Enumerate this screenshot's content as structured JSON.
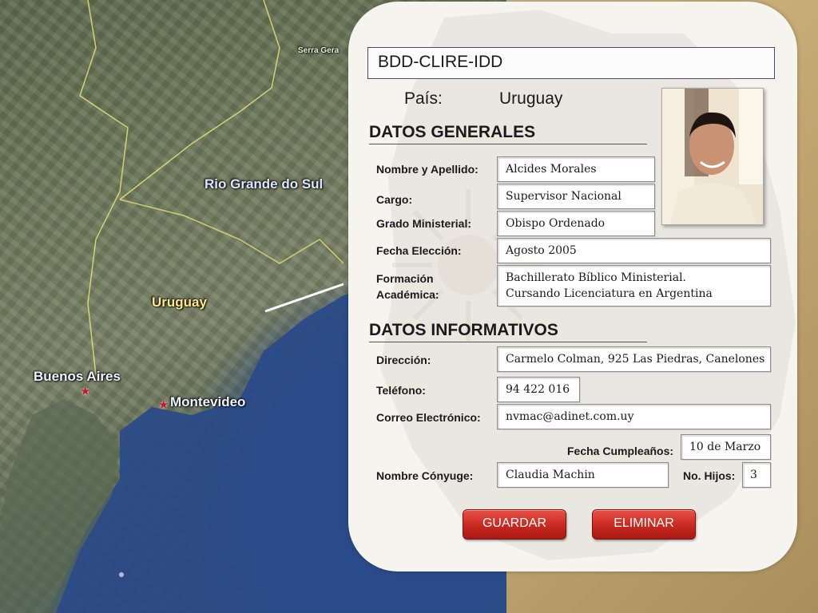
{
  "map": {
    "labels": {
      "serra": "Serra Gera",
      "rio_grande": "Rio Grande do Sul",
      "uruguay": "Uruguay",
      "buenos_aires": "Buenos Aires",
      "montevideo": "Montevideo"
    }
  },
  "form": {
    "title": "BDD-CLIRE-IDD",
    "pais_label": "País:",
    "pais_value": "Uruguay",
    "sections": {
      "generales": "DATOS GENERALES",
      "informativos": "DATOS INFORMATIVOS"
    },
    "fields": {
      "nombre": {
        "label": "Nombre y Apellido:",
        "value": "Alcides Morales"
      },
      "cargo": {
        "label": "Cargo:",
        "value": "Supervisor Nacional"
      },
      "grado": {
        "label": "Grado Ministerial:",
        "value": "Obispo Ordenado"
      },
      "fecha_eleccion": {
        "label": "Fecha Elección:",
        "value": "Agosto 2005"
      },
      "formacion": {
        "label_1": "Formación",
        "label_2": "Académica:",
        "value_1": "Bachillerato Bíblico Ministerial.",
        "value_2": "Cursando Licenciatura en Argentina"
      },
      "direccion": {
        "label": "Dirección:",
        "value": "Carmelo Colman, 925 Las Piedras, Canelones"
      },
      "telefono": {
        "label": "Teléfono:",
        "value": "94 422 016"
      },
      "correo": {
        "label": "Correo Electrónico:",
        "value": "nvmac@adinet.com.uy"
      },
      "cumpleanos": {
        "label": "Fecha Cumpleaños:",
        "value": "10 de Marzo"
      },
      "conyuge": {
        "label": "Nombre Cónyuge:",
        "value": "Claudia Machin"
      },
      "hijos": {
        "label": "No. Hijos:",
        "value": "3"
      }
    },
    "buttons": {
      "guardar": "GUARDAR",
      "eliminar": "ELIMINAR"
    }
  },
  "colors": {
    "button_red": "#c8281f",
    "map_water": "#2d4f8c",
    "card_bg": "#f6f4ef"
  }
}
